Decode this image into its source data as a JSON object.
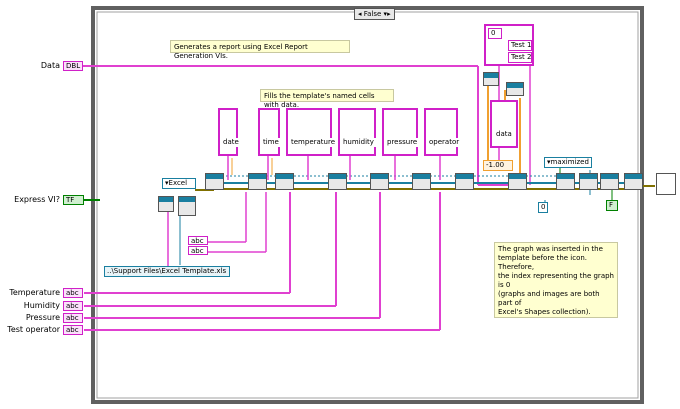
{
  "case_selector": {
    "value": "False"
  },
  "comments": {
    "generates": "Generates a report using Excel Report Generation VIs.",
    "fills": "Fills the template's named cells with data.",
    "graph_note": [
      "The graph was inserted in the",
      "template before the icon. Therefore,",
      "the index representing the graph is 0",
      "(graphs and images are both part of",
      "Excel's Shapes collection)."
    ]
  },
  "inputs": {
    "data": "Data",
    "express_vi": "Express VI?",
    "temperature": "Temperature",
    "humidity": "Humidity",
    "pressure": "Pressure",
    "test_operator": "Test operator"
  },
  "terminal_types": {
    "dbl": "DBL",
    "tf": "TF",
    "abc": "abc"
  },
  "named_cells": [
    "date",
    "time",
    "temperature",
    "humidity",
    "pressure",
    "operator"
  ],
  "test_list": [
    "Test 1",
    "Test 2"
  ],
  "constants": {
    "excel": "Excel",
    "template_path": "..\\Support Files\\Excel Template.xls",
    "data": "data",
    "offset": "-1.00",
    "zero_top": "0",
    "zero_bottom": "0",
    "window_state": "maximized",
    "false_const": "F",
    "abc": "abc"
  },
  "colors": {
    "pink_wire": "#e040d0",
    "orange_wire": "#f0a030",
    "ref_wire": "#1a7fa0",
    "bool_wire": "#008000",
    "error_wire": "#807000"
  }
}
